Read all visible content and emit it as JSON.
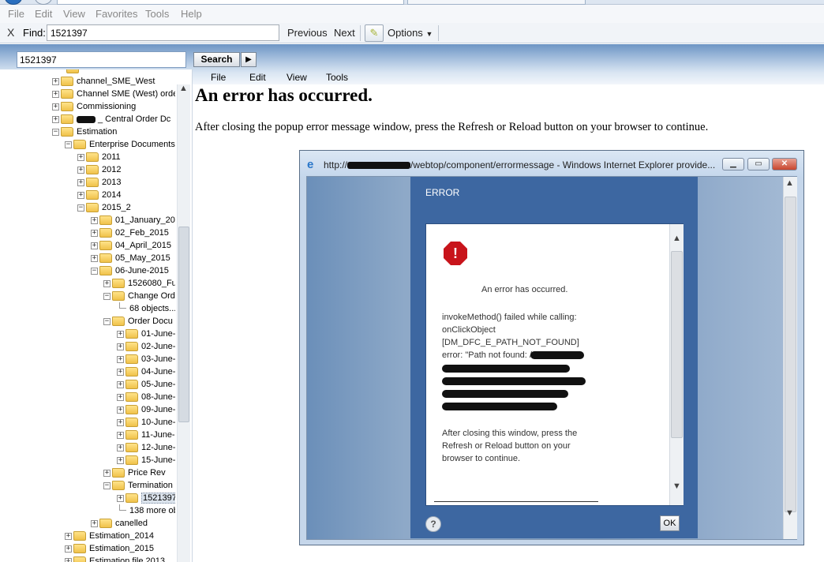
{
  "menubar": {
    "items": [
      "File",
      "Edit",
      "View",
      "Favorites",
      "Tools",
      "Help"
    ]
  },
  "findbar": {
    "close_glyph": "X",
    "label": "Find:",
    "value": "1521397",
    "previous": "Previous",
    "next": "Next",
    "options": "Options"
  },
  "webtop": {
    "search_value": "1521397",
    "search_button": "Search",
    "search_arrow": "▶",
    "menu": [
      "File",
      "Edit",
      "View",
      "Tools"
    ]
  },
  "tree": {
    "nodes": [
      {
        "label": "channel_SME_West"
      },
      {
        "label": "Channel SME (West) orde"
      },
      {
        "label": "Commissioning"
      },
      {
        "label": "_ Central Order Dc"
      },
      {
        "label": "Estimation"
      },
      {
        "label": "Enterprise Documents"
      },
      {
        "label": "2011"
      },
      {
        "label": "2012"
      },
      {
        "label": "2013"
      },
      {
        "label": "2014"
      },
      {
        "label": "2015_2"
      },
      {
        "label": "01_January_20"
      },
      {
        "label": "02_Feb_2015"
      },
      {
        "label": "04_April_2015"
      },
      {
        "label": "05_May_2015"
      },
      {
        "label": "06-June-2015"
      },
      {
        "label": "1526080_Fu"
      },
      {
        "label": "Change Ord"
      },
      {
        "label": "68 objects..."
      },
      {
        "label": "Order Docu"
      },
      {
        "label": "01-June-"
      },
      {
        "label": "02-June-"
      },
      {
        "label": "03-June-"
      },
      {
        "label": "04-June-"
      },
      {
        "label": "05-June-"
      },
      {
        "label": "08-June-"
      },
      {
        "label": "09-June-"
      },
      {
        "label": "10-June-"
      },
      {
        "label": "11-June-"
      },
      {
        "label": "12-June-"
      },
      {
        "label": "15-June-"
      },
      {
        "label": "Price Rev"
      },
      {
        "label": "Termination"
      },
      {
        "label": "1521397"
      },
      {
        "label": "138 more ob"
      },
      {
        "label": "canelled"
      },
      {
        "label": "Estimation_2014"
      },
      {
        "label": "Estimation_2015"
      },
      {
        "label": "Estimation file 2013"
      }
    ]
  },
  "content": {
    "title": "An error has occurred.",
    "message": "After closing the popup error message window, press the Refresh or Reload button on your browser to continue."
  },
  "popup": {
    "title_prefix": "http://",
    "title_suffix": "/webtop/component/errormessage - Windows Internet Explorer provide...",
    "panel_header": "ERROR",
    "error_heading": "An error has occurred.",
    "lines": [
      "invokeMethod() failed while calling:",
      "onClickObject",
      "[DM_DFC_E_PATH_NOT_FOUND]",
      "error: \"Path not found: /"
    ],
    "after_lines": [
      "After closing this window, press the",
      "Refresh or Reload button on your",
      "browser to continue."
    ],
    "help": "?",
    "ok": "OK"
  }
}
